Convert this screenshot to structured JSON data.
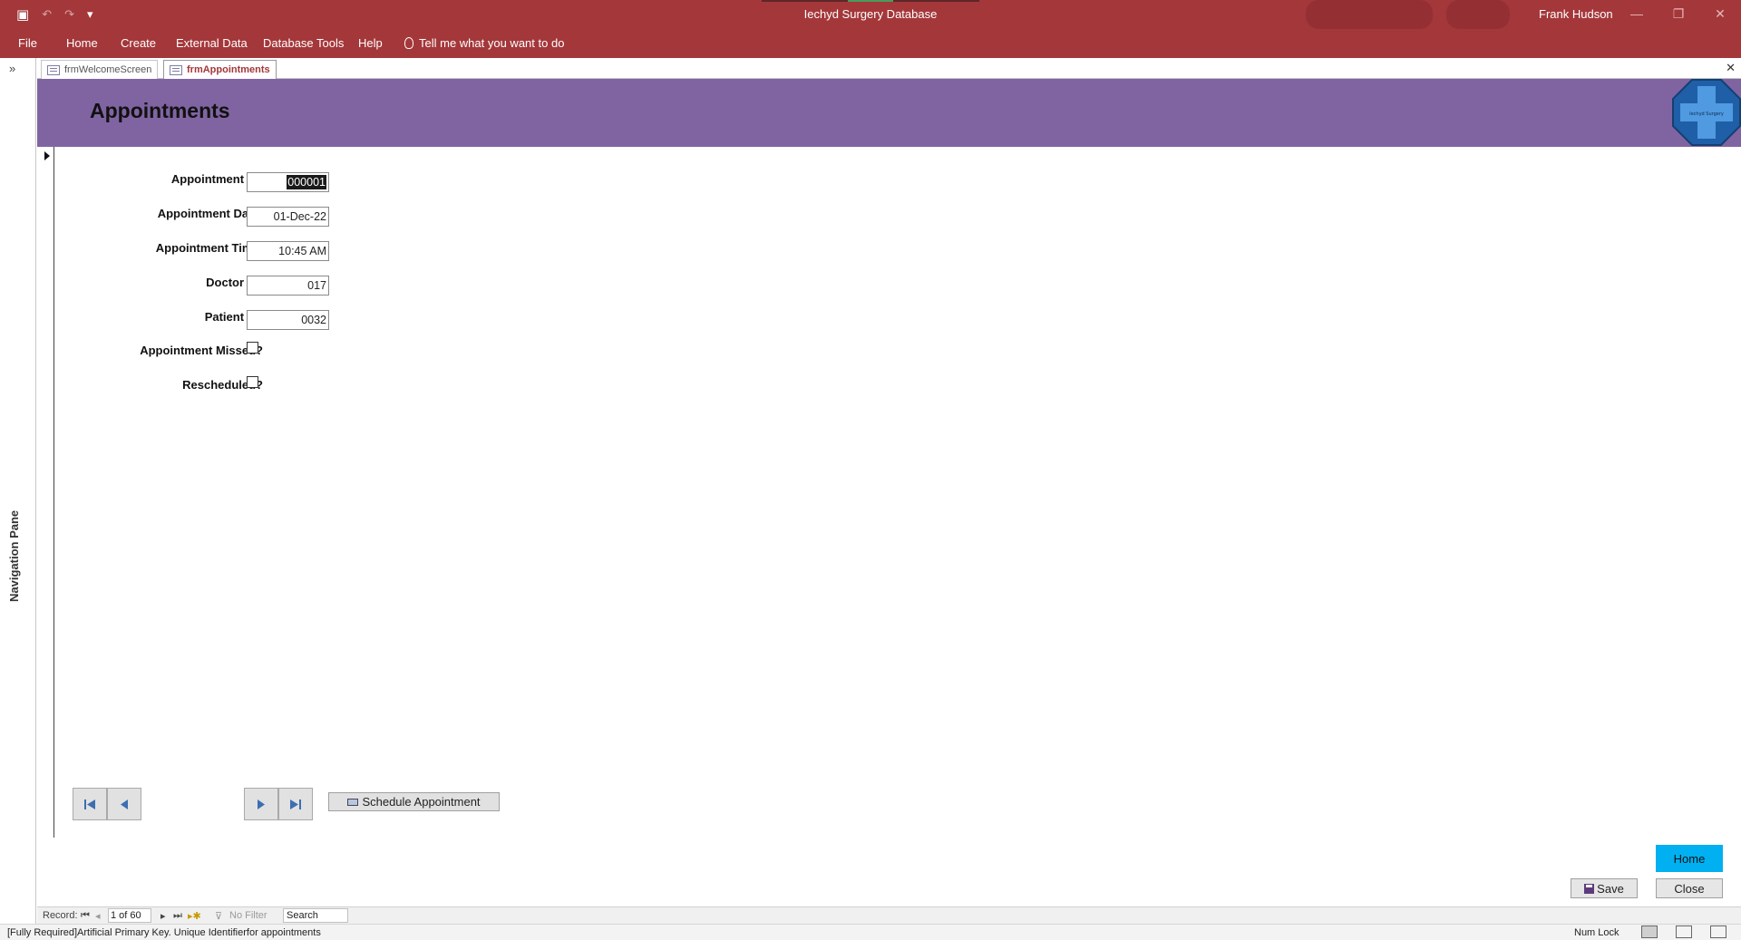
{
  "window": {
    "title": "Iechyd Surgery Database",
    "user": "Frank Hudson",
    "minimize": "—",
    "restore": "❐",
    "close": "✕"
  },
  "qat": {
    "save_icon": "▣",
    "undo_icon": "↶",
    "redo_icon": "↷",
    "customize_icon": "▾"
  },
  "ribbon": {
    "tabs": [
      "File",
      "Home",
      "Create",
      "External Data",
      "Database Tools",
      "Help"
    ],
    "tell_me": "Tell me what you want to do"
  },
  "nav_pane": {
    "label": "Navigation Pane",
    "expand_icon": "»"
  },
  "doc_tabs": {
    "tabs": [
      "frmWelcomeScreen",
      "frmAppointments"
    ],
    "active_index": 1,
    "close_icon": "✕"
  },
  "form": {
    "title": "Appointments",
    "logo_text": "Iechyd Surgery",
    "fields": {
      "appointment_id": {
        "label": "Appointment ID:",
        "value": "000001"
      },
      "appointment_date": {
        "label": "Appointment Date:",
        "value": "01-Dec-22"
      },
      "appointment_time": {
        "label": "Appointment Time:",
        "value": "10:45 AM"
      },
      "doctor_id": {
        "label": "Doctor ID:",
        "value": "017"
      },
      "patient_id": {
        "label": "Patient ID:",
        "value": "0032"
      },
      "appointment_missed": {
        "label": "Appointment Missed?",
        "checked": false
      },
      "rescheduled": {
        "label": "Rescheduled?",
        "checked": false
      }
    },
    "buttons": {
      "schedule": "Schedule Appointment",
      "home": "Home",
      "save": "Save",
      "close": "Close"
    }
  },
  "record_bar": {
    "label": "Record:",
    "position": "1 of 60",
    "filter": "No Filter",
    "search": "Search",
    "first_icon": "⏮",
    "prev_icon": "◂",
    "next_icon": "▸",
    "last_icon": "⏭",
    "new_icon": "▸✱",
    "filter_icon": "⊽"
  },
  "status_bar": {
    "text": "[Fully Required]Artificial Primary Key. Unique Identifierfor appointments",
    "num_lock": "Num Lock"
  },
  "colors": {
    "titlebar": "#a4373a",
    "form_header": "#8064a2",
    "home_button": "#00b0f0",
    "nav_arrow": "#3b6fb0"
  }
}
